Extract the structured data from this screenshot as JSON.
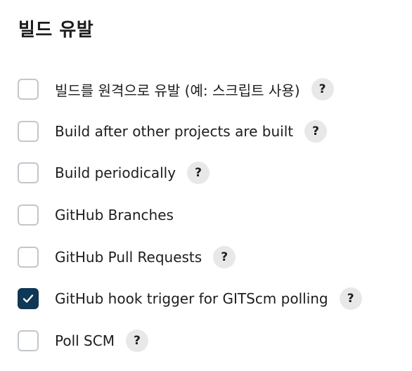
{
  "section": {
    "title": "빌드 유발"
  },
  "triggers": [
    {
      "label": "빌드를 원격으로 유발 (예: 스크립트 사용)",
      "checked": false,
      "help": "?"
    },
    {
      "label": "Build after other projects are built",
      "checked": false,
      "help": "?"
    },
    {
      "label": "Build periodically",
      "checked": false,
      "help": "?"
    },
    {
      "label": "GitHub Branches",
      "checked": false,
      "help": ""
    },
    {
      "label": "GitHub Pull Requests",
      "checked": false,
      "help": "?"
    },
    {
      "label": "GitHub hook trigger for GITScm polling",
      "checked": true,
      "help": "?"
    },
    {
      "label": "Poll SCM",
      "checked": false,
      "help": "?"
    }
  ],
  "colors": {
    "checkbox_checked": "#0f3756",
    "checkbox_border": "#c2c7cc",
    "help_bg": "#e8e8e8"
  },
  "icons": {
    "check": "check-icon",
    "help": "help-icon"
  }
}
